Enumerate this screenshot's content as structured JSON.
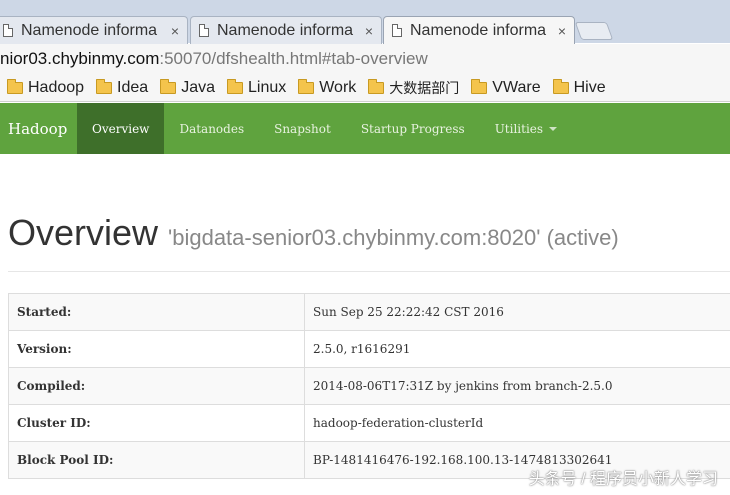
{
  "browser": {
    "tabs": [
      {
        "title": "Namenode informa",
        "close": "×"
      },
      {
        "title": "Namenode informa",
        "close": "×"
      },
      {
        "title": "Namenode informa",
        "close": "×"
      }
    ],
    "address": {
      "host": "nior03.chybinmy.com",
      "rest": ":50070/dfshealth.html#tab-overview"
    },
    "bookmarks": [
      "Hadoop",
      "Idea",
      "Java",
      "Linux",
      "Work",
      "大数据部门",
      "VWare",
      "Hive"
    ]
  },
  "navbar": {
    "brand": "Hadoop",
    "items": [
      "Overview",
      "Datanodes",
      "Snapshot",
      "Startup Progress",
      "Utilities"
    ],
    "active": "Overview"
  },
  "overview": {
    "title": "Overview",
    "subtitle": "'bigdata-senior03.chybinmy.com:8020' (active)"
  },
  "info_table": [
    {
      "key": "Started:",
      "value": "Sun Sep 25 22:22:42 CST 2016"
    },
    {
      "key": "Version:",
      "value": "2.5.0, r1616291"
    },
    {
      "key": "Compiled:",
      "value": "2014-08-06T17:31Z by jenkins from branch-2.5.0"
    },
    {
      "key": "Cluster ID:",
      "value": "hadoop-federation-clusterId"
    },
    {
      "key": "Block Pool ID:",
      "value": "BP-1481416476-192.168.100.13-1474813302641"
    }
  ],
  "watermark": "头条号 / 程序员小新人学习",
  "colors": {
    "navbar": "#5fa33e",
    "navbar_active": "#3e6f2a"
  }
}
